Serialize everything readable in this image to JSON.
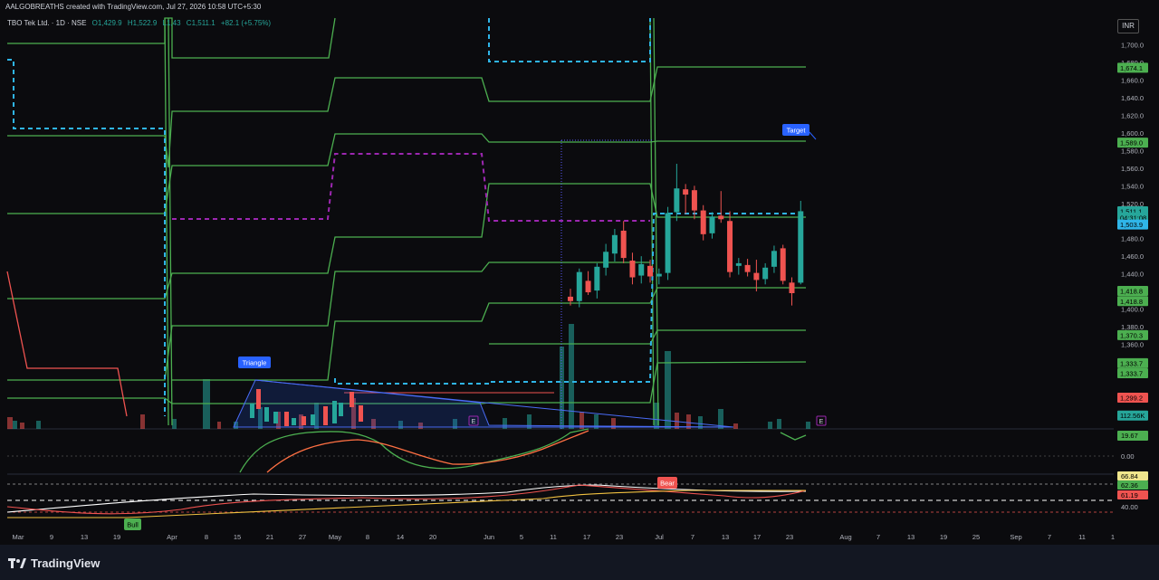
{
  "caption": "AALGOBREATHS created with TradingView.com, Jul 27, 2026 10:58 UTC+5:30",
  "legend": {
    "symbol": "TBO Tek Ltd. · 1D · NSE",
    "open": "O1,429.9",
    "high": "H1,522.9",
    "low": "L1,43",
    "close": "C1,511.1",
    "change": "+82.1 (+5.75%)"
  },
  "currency": "INR",
  "colors": {
    "up": "#26a69a",
    "down": "#ef5350",
    "band": "#4caf50",
    "blue_dash": "#2fb5e8",
    "purple_dash": "#9c27b0"
  },
  "annotations": {
    "target": "Target",
    "triangle": "Triangle",
    "bull": "Bull",
    "bear": "Bear",
    "e_marker": "E"
  },
  "price_axis": {
    "ticks": [
      "1,700.0",
      "1,680.0",
      "1,660.0",
      "1,640.0",
      "1,620.0",
      "1,600.0",
      "1,580.0",
      "1,560.0",
      "1,540.0",
      "1,520.0",
      "1,480.0",
      "1,460.0",
      "1,440.0",
      "1,400.0",
      "1,380.0",
      "1,360.0",
      "1,340.0",
      "1,280.0"
    ],
    "tick_values": [
      1700,
      1680,
      1660,
      1640,
      1620,
      1600,
      1580,
      1560,
      1540,
      1520,
      1480,
      1460,
      1440,
      1400,
      1380,
      1360,
      1340,
      1280
    ],
    "labels": [
      {
        "text": "1,674.1",
        "value": 1674.1,
        "color": "#4caf50"
      },
      {
        "text": "1,589.0",
        "value": 1589.0,
        "color": "#4caf50"
      },
      {
        "text": "1,511.1",
        "value": 1511.1,
        "color": "#26a69a"
      },
      {
        "text": "04:31:08",
        "value": 1504.0,
        "color": "#26a69a"
      },
      {
        "text": "1,503.9",
        "value": 1496.0,
        "color": "#2fb5e8"
      },
      {
        "text": "1,418.8",
        "value": 1420.6,
        "color": "#4caf50"
      },
      {
        "text": "1,418.8",
        "value": 1409.0,
        "color": "#4caf50"
      },
      {
        "text": "1,370.3",
        "value": 1370.3,
        "color": "#4caf50"
      },
      {
        "text": "1,333.7",
        "value": 1338.5,
        "color": "#4caf50"
      },
      {
        "text": "1,333.7",
        "value": 1327.0,
        "color": "#4caf50"
      },
      {
        "text": "1,299.2",
        "value": 1299.2,
        "color": "#ef5350"
      },
      {
        "text": "112.56K",
        "value": 1279.0,
        "color": "#26a69a"
      }
    ]
  },
  "macd_axis": {
    "labels": [
      {
        "text": "19.67",
        "color": "#4caf50"
      }
    ],
    "ticks": [
      "0.00"
    ]
  },
  "rsi_axis": {
    "labels": [
      {
        "text": "66.84",
        "color": "#f0e68c"
      },
      {
        "text": "62.36",
        "color": "#4caf50"
      },
      {
        "text": "61.19",
        "color": "#ef5350"
      }
    ],
    "ticks": [
      "40.00"
    ]
  },
  "time_axis": [
    "Mar",
    "9",
    "13",
    "19",
    "Apr",
    "8",
    "15",
    "21",
    "27",
    "May",
    "8",
    "14",
    "20",
    "Jun",
    "5",
    "11",
    "17",
    "23",
    "Jul",
    "7",
    "13",
    "17",
    "23",
    "Aug",
    "7",
    "13",
    "19",
    "25",
    "Sep",
    "7",
    "11",
    "1"
  ],
  "chart_data": {
    "type": "candlestick",
    "series": [
      {
        "name": "TBO Tek Ltd.",
        "ohlc": [
          {
            "o": 1414,
            "h": 1423,
            "l": 1404,
            "c": 1409
          },
          {
            "o": 1409,
            "h": 1446,
            "l": 1402,
            "c": 1442
          },
          {
            "o": 1432,
            "h": 1443,
            "l": 1416,
            "c": 1419
          },
          {
            "o": 1421,
            "h": 1452,
            "l": 1412,
            "c": 1448
          },
          {
            "o": 1447,
            "h": 1474,
            "l": 1438,
            "c": 1465
          },
          {
            "o": 1463,
            "h": 1491,
            "l": 1454,
            "c": 1484
          },
          {
            "o": 1489,
            "h": 1500,
            "l": 1452,
            "c": 1458
          },
          {
            "o": 1455,
            "h": 1464,
            "l": 1428,
            "c": 1436
          },
          {
            "o": 1438,
            "h": 1460,
            "l": 1429,
            "c": 1451
          },
          {
            "o": 1449,
            "h": 1456,
            "l": 1430,
            "c": 1437
          },
          {
            "o": 1437,
            "h": 1446,
            "l": 1428,
            "c": 1440
          },
          {
            "o": 1441,
            "h": 1516,
            "l": 1433,
            "c": 1509
          },
          {
            "o": 1510,
            "h": 1565,
            "l": 1500,
            "c": 1537
          },
          {
            "o": 1536,
            "h": 1542,
            "l": 1508,
            "c": 1530
          },
          {
            "o": 1535,
            "h": 1540,
            "l": 1502,
            "c": 1512
          },
          {
            "o": 1512,
            "h": 1518,
            "l": 1478,
            "c": 1485
          },
          {
            "o": 1486,
            "h": 1510,
            "l": 1480,
            "c": 1505
          },
          {
            "o": 1506,
            "h": 1534,
            "l": 1498,
            "c": 1502
          },
          {
            "o": 1500,
            "h": 1511,
            "l": 1436,
            "c": 1442
          },
          {
            "o": 1449,
            "h": 1458,
            "l": 1439,
            "c": 1452
          },
          {
            "o": 1450,
            "h": 1457,
            "l": 1437,
            "c": 1442
          },
          {
            "o": 1441,
            "h": 1456,
            "l": 1420,
            "c": 1433
          },
          {
            "o": 1434,
            "h": 1452,
            "l": 1428,
            "c": 1447
          },
          {
            "o": 1448,
            "h": 1472,
            "l": 1441,
            "c": 1466
          },
          {
            "o": 1469,
            "h": 1473,
            "l": 1428,
            "c": 1432
          },
          {
            "o": 1430,
            "h": 1436,
            "l": 1404,
            "c": 1418
          },
          {
            "o": 1429.9,
            "h": 1522.9,
            "l": 1428,
            "c": 1511.1
          }
        ]
      }
    ]
  }
}
